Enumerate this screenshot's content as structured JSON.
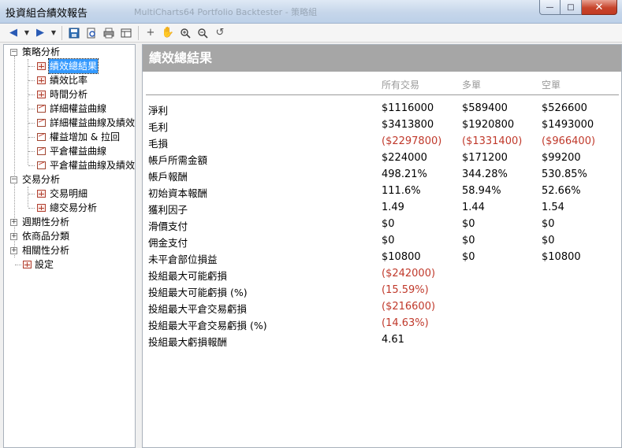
{
  "window": {
    "title": "投資組合績效報告",
    "background_title": "MultiCharts64 Portfolio Backtester - 策略組",
    "buttons": {
      "minimize": "—",
      "maximize": "□",
      "close": "✕"
    }
  },
  "toolbar": {
    "icons": [
      "back-arrow-icon",
      "dropdown-icon",
      "forward-arrow-icon",
      "dropdown-icon",
      "save-icon",
      "print-preview-icon",
      "print-icon",
      "table-view-icon",
      "crosshair-icon",
      "hand-pan-icon",
      "zoom-in-icon",
      "zoom-out-icon",
      "reset-zoom-icon"
    ]
  },
  "tree": {
    "nodes": [
      {
        "label": "策略分析",
        "expander": "−"
      },
      {
        "label": "績效總結果",
        "icon": "grid",
        "selected": true
      },
      {
        "label": "績效比率",
        "icon": "grid"
      },
      {
        "label": "時間分析",
        "icon": "grid"
      },
      {
        "label": "詳細權益曲線",
        "icon": "chart"
      },
      {
        "label": "詳細權益曲線及績效:",
        "icon": "chart"
      },
      {
        "label": "權益增加 & 拉回",
        "icon": "chart"
      },
      {
        "label": "平倉權益曲線",
        "icon": "chart"
      },
      {
        "label": "平倉權益曲線及績效:",
        "icon": "chart"
      },
      {
        "label": "交易分析",
        "expander": "−"
      },
      {
        "label": "交易明細",
        "icon": "grid"
      },
      {
        "label": "總交易分析",
        "icon": "grid"
      },
      {
        "label": "週期性分析",
        "expander": "+"
      },
      {
        "label": "依商品分類",
        "expander": "+"
      },
      {
        "label": "相關性分析",
        "expander": "+"
      },
      {
        "label": "設定",
        "icon": "grid"
      }
    ]
  },
  "report": {
    "title": "績效總結果",
    "columns": [
      "所有交易",
      "多單",
      "空單"
    ],
    "rows": [
      {
        "label": "淨利",
        "values": [
          "$1116000",
          "$589400",
          "$526600"
        ],
        "negative": false
      },
      {
        "label": "毛利",
        "values": [
          "$3413800",
          "$1920800",
          "$1493000"
        ],
        "negative": false
      },
      {
        "label": "毛損",
        "values": [
          "($2297800)",
          "($1331400)",
          "($966400)"
        ],
        "negative": true
      },
      {
        "label": "帳戶所需金額",
        "values": [
          "$224000",
          "$171200",
          "$99200"
        ],
        "negative": false
      },
      {
        "label": "帳戶報酬",
        "values": [
          "498.21%",
          "344.28%",
          "530.85%"
        ],
        "negative": false
      },
      {
        "label": "初始資本報酬",
        "values": [
          "111.6%",
          "58.94%",
          "52.66%"
        ],
        "negative": false
      },
      {
        "label": "獲利因子",
        "values": [
          "1.49",
          "1.44",
          "1.54"
        ],
        "negative": false
      },
      {
        "label": "滑價支付",
        "values": [
          "$0",
          "$0",
          "$0"
        ],
        "negative": false
      },
      {
        "label": "佣金支付",
        "values": [
          "$0",
          "$0",
          "$0"
        ],
        "negative": false
      },
      {
        "label": "未平倉部位損益",
        "values": [
          "$10800",
          "$0",
          "$10800"
        ],
        "negative": false
      },
      {
        "label": "投組最大可能虧損",
        "values": [
          "($242000)"
        ],
        "negative": true
      },
      {
        "label": "投組最大可能虧損 (%)",
        "values": [
          "(15.59%)"
        ],
        "negative": true
      },
      {
        "label": "投組最大平倉交易虧損",
        "values": [
          "($216600)"
        ],
        "negative": true
      },
      {
        "label": "投組最大平倉交易虧損 (%)",
        "values": [
          "(14.63%)"
        ],
        "negative": true
      },
      {
        "label": "投組最大虧損報酬",
        "values": [
          "4.61"
        ],
        "negative": false
      }
    ],
    "negative_color": "#c0392b"
  }
}
